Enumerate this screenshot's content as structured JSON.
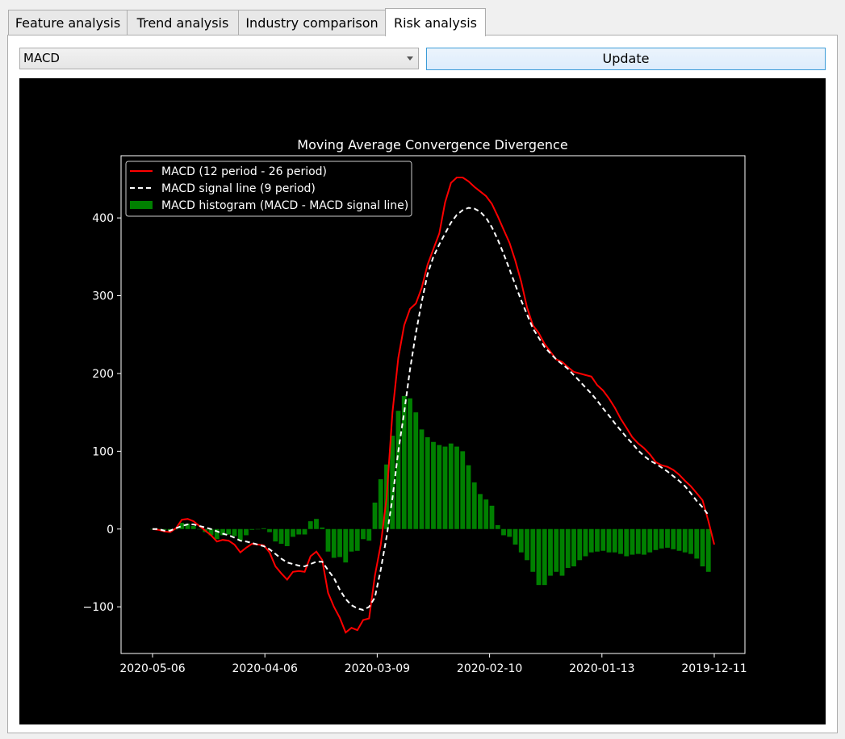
{
  "tabs": [
    {
      "label": "Feature analysis",
      "active": false
    },
    {
      "label": "Trend analysis",
      "active": false
    },
    {
      "label": "Industry comparison",
      "active": false
    },
    {
      "label": "Risk analysis",
      "active": true
    }
  ],
  "controls": {
    "indicator_select": "MACD",
    "update_label": "Update"
  },
  "colors": {
    "macd": "#ff0000",
    "signal": "#ffffff",
    "histogram": "#008000",
    "background": "#000000"
  },
  "chart_data": {
    "type": "line",
    "title": "Moving Average Convergence Divergence",
    "xlabel": "",
    "ylabel": "",
    "x_tick_labels": [
      "2020-05-06",
      "2020-04-06",
      "2020-03-09",
      "2020-02-10",
      "2020-01-13",
      "2019-12-11"
    ],
    "y_ticks": [
      -100,
      0,
      100,
      200,
      300,
      400
    ],
    "ylim": [
      -160,
      480
    ],
    "x_direction": "newest-to-oldest, left-to-right",
    "legend_position": "top-left",
    "series": [
      {
        "name": "MACD (12 period - 26 period)",
        "kind": "line",
        "color": "#ff0000",
        "values": [
          0,
          -1,
          -3,
          -4,
          1,
          12,
          13,
          10,
          4,
          -2,
          -8,
          -16,
          -14,
          -15,
          -20,
          -30,
          -24,
          -19,
          -20,
          -21,
          -30,
          -48,
          -57,
          -65,
          -55,
          -54,
          -55,
          -35,
          -29,
          -40,
          -82,
          -100,
          -114,
          -133,
          -127,
          -130,
          -117,
          -115,
          -60,
          -20,
          40,
          150,
          220,
          262,
          283,
          290,
          310,
          340,
          360,
          380,
          420,
          445,
          452,
          452,
          447,
          440,
          434,
          428,
          418,
          402,
          385,
          368,
          345,
          318,
          285,
          262,
          252,
          238,
          228,
          218,
          215,
          208,
          202,
          200,
          198,
          196,
          185,
          178,
          168,
          156,
          142,
          130,
          118,
          110,
          104,
          96,
          86,
          82,
          80,
          76,
          70,
          62,
          55,
          46,
          37,
          10,
          -20
        ]
      },
      {
        "name": "MACD signal line (9 period)",
        "kind": "dashed-line",
        "color": "#ffffff",
        "values": [
          0,
          0,
          -2,
          -2,
          1,
          4,
          6,
          6,
          4,
          2,
          0,
          -3,
          -6,
          -8,
          -11,
          -15,
          -16,
          -18,
          -20,
          -22,
          -26,
          -32,
          -38,
          -43,
          -45,
          -47,
          -48,
          -45,
          -42,
          -42,
          -53,
          -63,
          -78,
          -90,
          -98,
          -102,
          -104,
          -100,
          -88,
          -52,
          -10,
          40,
          100,
          150,
          205,
          252,
          292,
          328,
          350,
          366,
          380,
          394,
          404,
          410,
          413,
          412,
          408,
          400,
          388,
          372,
          354,
          334,
          314,
          294,
          276,
          258,
          246,
          234,
          226,
          218,
          212,
          206,
          198,
          190,
          182,
          174,
          165,
          155,
          146,
          136,
          127,
          118,
          110,
          101,
          94,
          88,
          84,
          79,
          74,
          68,
          62,
          55,
          46,
          36,
          28,
          18
        ]
      },
      {
        "name": "MACD histogram (MACD - MACD signal line)",
        "kind": "bar",
        "color": "#008000",
        "values": [
          0,
          -1,
          -1,
          -2,
          0,
          8,
          7,
          4,
          0,
          -4,
          -8,
          -13,
          -8,
          -7,
          -9,
          -15,
          -8,
          -1,
          0,
          1,
          -4,
          -16,
          -19,
          -22,
          -10,
          -7,
          -7,
          10,
          13,
          2,
          -29,
          -37,
          -36,
          -43,
          -29,
          -28,
          -13,
          -15,
          34,
          64,
          83,
          120,
          152,
          171,
          168,
          150,
          128,
          118,
          112,
          108,
          106,
          110,
          106,
          100,
          82,
          60,
          45,
          38,
          30,
          5,
          -8,
          -10,
          -20,
          -30,
          -40,
          -55,
          -72,
          -72,
          -60,
          -55,
          -60,
          -50,
          -48,
          -40,
          -35,
          -30,
          -29,
          -28,
          -30,
          -30,
          -32,
          -35,
          -33,
          -32,
          -33,
          -30,
          -27,
          -25,
          -24,
          -26,
          -28,
          -30,
          -32,
          -38,
          -48,
          -55
        ]
      }
    ]
  }
}
